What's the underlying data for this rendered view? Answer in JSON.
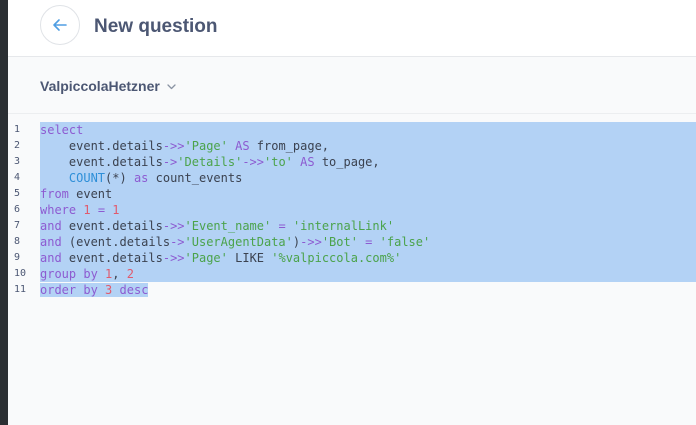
{
  "header": {
    "title": "New question",
    "back_icon": "arrow-left-icon"
  },
  "database": {
    "name": "ValpiccolaHetzner",
    "dropdown_icon": "chevron-down-icon"
  },
  "editor": {
    "lines": [
      {
        "n": "1",
        "tokens": [
          {
            "t": "select",
            "c": "kw"
          }
        ]
      },
      {
        "n": "2",
        "tokens": [
          {
            "t": "    event.details",
            "c": "tx"
          },
          {
            "t": "->>",
            "c": "kw"
          },
          {
            "t": "'Page'",
            "c": "str"
          },
          {
            "t": " ",
            "c": "tx"
          },
          {
            "t": "AS",
            "c": "kw"
          },
          {
            "t": " from_page,",
            "c": "tx"
          }
        ]
      },
      {
        "n": "3",
        "tokens": [
          {
            "t": "    event.details",
            "c": "tx"
          },
          {
            "t": "->",
            "c": "kw"
          },
          {
            "t": "'Details'",
            "c": "str"
          },
          {
            "t": "->>",
            "c": "kw"
          },
          {
            "t": "'to'",
            "c": "str"
          },
          {
            "t": " ",
            "c": "tx"
          },
          {
            "t": "AS",
            "c": "kw"
          },
          {
            "t": " to_page,",
            "c": "tx"
          }
        ]
      },
      {
        "n": "4",
        "tokens": [
          {
            "t": "    ",
            "c": "tx"
          },
          {
            "t": "COUNT",
            "c": "fn"
          },
          {
            "t": "(*) ",
            "c": "tx"
          },
          {
            "t": "as",
            "c": "kw"
          },
          {
            "t": " count_events",
            "c": "tx"
          }
        ]
      },
      {
        "n": "5",
        "tokens": [
          {
            "t": "from",
            "c": "kw"
          },
          {
            "t": " event",
            "c": "tx"
          }
        ]
      },
      {
        "n": "6",
        "tokens": [
          {
            "t": "where",
            "c": "kw"
          },
          {
            "t": " ",
            "c": "tx"
          },
          {
            "t": "1",
            "c": "num"
          },
          {
            "t": " ",
            "c": "tx"
          },
          {
            "t": "=",
            "c": "kw"
          },
          {
            "t": " ",
            "c": "tx"
          },
          {
            "t": "1",
            "c": "num"
          }
        ]
      },
      {
        "n": "7",
        "tokens": [
          {
            "t": "and",
            "c": "kw"
          },
          {
            "t": " event.details",
            "c": "tx"
          },
          {
            "t": "->>",
            "c": "kw"
          },
          {
            "t": "'Event_name'",
            "c": "str"
          },
          {
            "t": " ",
            "c": "tx"
          },
          {
            "t": "=",
            "c": "kw"
          },
          {
            "t": " ",
            "c": "tx"
          },
          {
            "t": "'internalLink'",
            "c": "str"
          }
        ]
      },
      {
        "n": "8",
        "tokens": [
          {
            "t": "and",
            "c": "kw"
          },
          {
            "t": " (event.details",
            "c": "tx"
          },
          {
            "t": "->",
            "c": "kw"
          },
          {
            "t": "'UserAgentData'",
            "c": "str"
          },
          {
            "t": ")",
            "c": "tx"
          },
          {
            "t": "->>",
            "c": "kw"
          },
          {
            "t": "'Bot'",
            "c": "str"
          },
          {
            "t": " ",
            "c": "tx"
          },
          {
            "t": "=",
            "c": "kw"
          },
          {
            "t": " ",
            "c": "tx"
          },
          {
            "t": "'false'",
            "c": "str"
          }
        ]
      },
      {
        "n": "9",
        "tokens": [
          {
            "t": "and",
            "c": "kw"
          },
          {
            "t": " event.details",
            "c": "tx"
          },
          {
            "t": "->>",
            "c": "kw"
          },
          {
            "t": "'Page'",
            "c": "str"
          },
          {
            "t": " LIKE ",
            "c": "tx"
          },
          {
            "t": "'%valpiccola.com%'",
            "c": "str"
          }
        ]
      },
      {
        "n": "10",
        "tokens": [
          {
            "t": "group",
            "c": "kw"
          },
          {
            "t": " ",
            "c": "tx"
          },
          {
            "t": "by",
            "c": "kw"
          },
          {
            "t": " ",
            "c": "tx"
          },
          {
            "t": "1",
            "c": "num"
          },
          {
            "t": ", ",
            "c": "tx"
          },
          {
            "t": "2",
            "c": "num"
          }
        ]
      },
      {
        "n": "11",
        "tokens": [
          {
            "t": "order",
            "c": "kw"
          },
          {
            "t": " ",
            "c": "tx"
          },
          {
            "t": "by",
            "c": "kw"
          },
          {
            "t": " ",
            "c": "tx"
          },
          {
            "t": "3",
            "c": "num"
          },
          {
            "t": " ",
            "c": "tx"
          },
          {
            "t": "desc",
            "c": "kw"
          }
        ]
      }
    ],
    "selected_lines": 11
  }
}
